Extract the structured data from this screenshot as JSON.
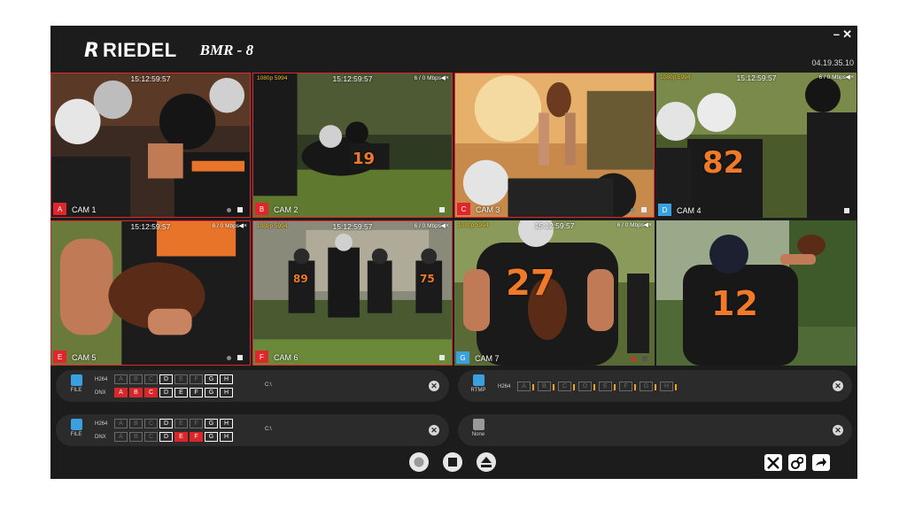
{
  "app": {
    "logo_mark": "R",
    "brand": "RIEDEL",
    "model": "BMR - 8",
    "minimize": "–",
    "close": "✕",
    "version": "04.19.35.10"
  },
  "tiles": [
    {
      "letter": "A",
      "label": "CAM 1",
      "time": "15:12:59:57",
      "rate": "",
      "res": "",
      "accent": "#e0262b",
      "live": true
    },
    {
      "letter": "B",
      "label": "CAM 2",
      "time": "15:12:59:57",
      "rate": "6 / 0 Mbps",
      "res": "1080p 5994",
      "accent": "#e0262b",
      "live": true
    },
    {
      "letter": "C",
      "label": "CAM 3",
      "time": "",
      "rate": "",
      "res": "",
      "accent": "#e0262b",
      "live": true
    },
    {
      "letter": "D",
      "label": "CAM 4",
      "time": "15:12:59:57",
      "rate": "6 / 0 Mbps",
      "res": "1080p 5994",
      "accent": "#3aa0e0",
      "live": false
    },
    {
      "letter": "E",
      "label": "CAM 5",
      "time": "15:12:59:57",
      "rate": "6 / 0 Mbps",
      "res": "",
      "accent": "#e0262b",
      "live": true
    },
    {
      "letter": "F",
      "label": "CAM 6",
      "time": "15:12:59:57",
      "rate": "6 / 0 Mbps",
      "res": "1080p 5994",
      "accent": "#e0262b",
      "live": true
    },
    {
      "letter": "G",
      "label": "CAM 7",
      "time": "15:12:59:57",
      "rate": "6 / 0 Mbps",
      "res": "1080p 5994",
      "accent": "#3aa0e0",
      "live": false
    },
    {
      "letter": "",
      "label": "",
      "time": "",
      "rate": "",
      "res": "",
      "accent": "",
      "live": false
    }
  ],
  "jerseys": {
    "t2": "19",
    "t4": "82",
    "t6a": "89",
    "t6b": "75",
    "t7": "27",
    "t8": "12"
  },
  "panels": {
    "file1": {
      "device": "FILE",
      "h264": "H264",
      "dnx": "DNX",
      "path": "C:\\"
    },
    "file2": {
      "device": "FILE",
      "h264": "H264",
      "dnx": "DNX",
      "path": "C:\\"
    },
    "rtmp": {
      "device": "RTMP",
      "h264": "H264"
    },
    "none": {
      "device": "None"
    }
  },
  "channels": [
    "A",
    "B",
    "C",
    "D",
    "E",
    "F",
    "G",
    "H"
  ],
  "close_glyph": "✕",
  "colors": {
    "accent_red": "#e0262b",
    "accent_blue": "#3aa0e0",
    "bg": "#1c1c1c",
    "panel": "#2b2b2b"
  }
}
